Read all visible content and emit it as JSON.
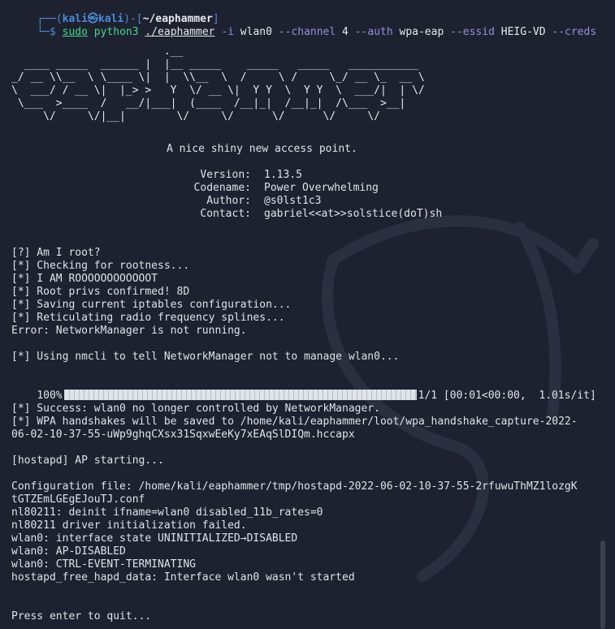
{
  "prompt": {
    "open": "┌──(",
    "user": "kali㉿kali",
    "mid": ")-[",
    "dir": "~/eaphammer",
    "close": "]",
    "line2": "└─",
    "dollar": "$ "
  },
  "command": {
    "sudo": "sudo",
    "python": "python3",
    "script": "./eaphammer",
    "parts": [
      {
        "text": "-i",
        "kind": "opt"
      },
      {
        "text": "wlan0",
        "kind": "arg"
      },
      {
        "text": "--channel",
        "kind": "opt"
      },
      {
        "text": "4",
        "kind": "arg"
      },
      {
        "text": "--auth",
        "kind": "opt"
      },
      {
        "text": "wpa-eap",
        "kind": "arg"
      },
      {
        "text": "--essid",
        "kind": "opt"
      },
      {
        "text": "HEIG-VD",
        "kind": "arg"
      },
      {
        "text": "--creds",
        "kind": "opt"
      }
    ]
  },
  "banner": "                        .__                                                  \n  ____ _____  ______ |  |__ _____    _____   _____   ___________ \n_/ __ \\\\__  \\ \\____ \\|  |  \\\\__  \\  /     \\ /     \\_/ __ \\_  __ \\\n\\  ___/ / __ \\|  |_> >   Y  \\/ __ \\|  Y Y  \\  Y Y  \\  ___/|  | \\/\n \\___  >____  /   __/|___|  (____  /__|_|  /__|_|  /\\___  >__|   \n     \\/     \\/|__|        \\/     \\/      \\/      \\/     \\/       ",
  "tagline": "A nice shiny new access point.",
  "info": [
    {
      "label": "Version:",
      "value": "1.13.5"
    },
    {
      "label": "Codename:",
      "value": "Power Overwhelming"
    },
    {
      "label": "Author:",
      "value": "@s0lst1c3"
    },
    {
      "label": "Contact:",
      "value": "gabriel<<at>>solstice(doT)sh"
    }
  ],
  "log1": [
    "[?] Am I root?",
    "[*] Checking for rootness...",
    "[*] I AM ROOOOOOOOOOOOT",
    "[*] Root privs confirmed! 8D",
    "[*] Saving current iptables configuration...",
    "[*] Reticulating radio frequency splines...",
    "Error: NetworkManager is not running."
  ],
  "nmcli_line": "[*] Using nmcli to tell NetworkManager not to manage wlan0...",
  "progress": {
    "percent_label": "100%",
    "fraction": 1.0,
    "stats": "1/1 [00:01<00:00,  1.01s/it]"
  },
  "log2": [
    "[*] Success: wlan0 no longer controlled by NetworkManager.",
    "[*] WPA handshakes will be saved to /home/kali/eaphammer/loot/wpa_handshake_capture-2022-",
    "06-02-10-37-55-uWp9ghqCXsx31SqxwEeKy7xEAqSlDIQm.hccapx"
  ],
  "hostapd_start": "[hostapd] AP starting...",
  "log3": [
    "Configuration file: /home/kali/eaphammer/tmp/hostapd-2022-06-02-10-37-55-2rfuwuThMZ1lozgK",
    "tGTZEmLGEgEJouTJ.conf",
    "nl80211: deinit ifname=wlan0 disabled_11b_rates=0",
    "nl80211 driver initialization failed.",
    "wlan0: interface state UNINITIALIZED→DISABLED",
    "wlan0: AP-DISABLED",
    "wlan0: CTRL-EVENT-TERMINATING",
    "hostapd_free_hapd_data: Interface wlan0 wasn't started"
  ],
  "quit": "Press enter to quit..."
}
